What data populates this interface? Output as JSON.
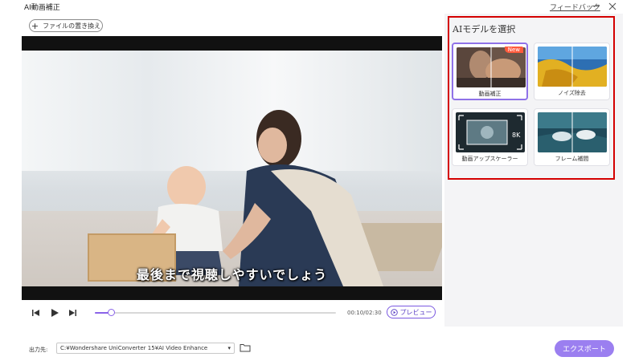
{
  "window": {
    "title": "AI動画補正",
    "feedback_link": "フィードバック",
    "minimize_icon": "minimize-icon",
    "close_icon": "close-icon"
  },
  "toolbar": {
    "replace_file_label": "ファイルの置き換え",
    "replace_icon": "plus-icon"
  },
  "video": {
    "subtitle": "最後まで視聴しやすいでしょう"
  },
  "playback": {
    "timecode": "00:10/02:30",
    "progress": 0.067,
    "preview_label": "プレビュー",
    "icons": [
      "previous-frame-icon",
      "play-icon",
      "next-frame-icon",
      "preview-play-icon"
    ]
  },
  "models": {
    "title": "AIモデルを選択",
    "cards": [
      {
        "label": "動画補正",
        "badge": "New",
        "selected": true
      },
      {
        "label": "ノイズ除去",
        "badge": "",
        "selected": false
      },
      {
        "label": "動画アップスケーラー",
        "badge": "",
        "selected": false,
        "thumb_text": "8K"
      },
      {
        "label": "フレーム補間",
        "badge": "",
        "selected": false
      }
    ]
  },
  "output": {
    "label": "出力先:",
    "path": "C:¥Wondershare UniConverter 15¥AI Video Enhance",
    "folder_icon": "folder-icon"
  },
  "export": {
    "label": "エクスポート",
    "color": "#9b7ff0"
  },
  "colors": {
    "accent": "#8a63e8",
    "highlight_border": "#d40000"
  }
}
